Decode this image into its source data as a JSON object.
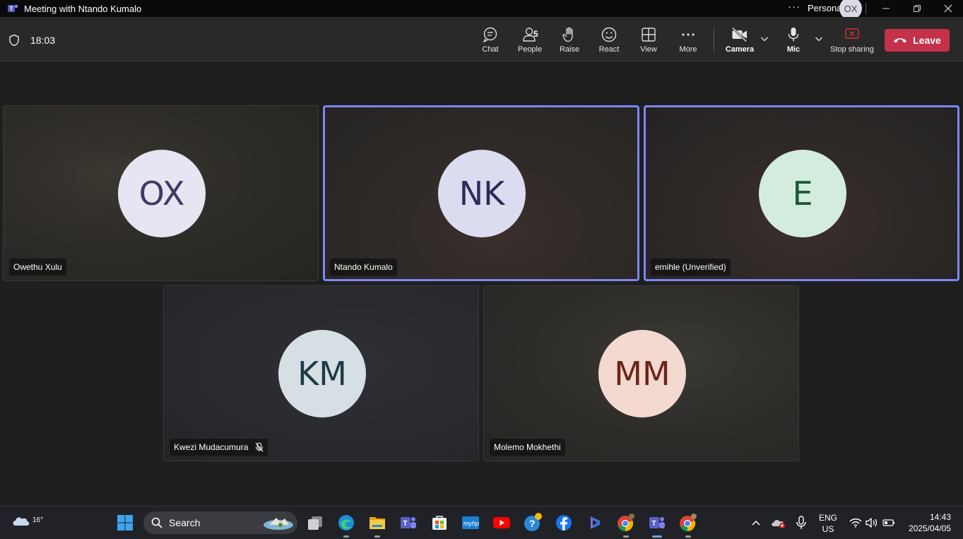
{
  "window": {
    "title": "Meeting with Ntando Kumalo",
    "profile_label": "Personal",
    "profile_initials": "OX",
    "more_dots": "···"
  },
  "toolbar": {
    "timer": "18:03",
    "chat": "Chat",
    "people": "People",
    "people_count": "5",
    "raise": "Raise",
    "react": "React",
    "view": "View",
    "more": "More",
    "camera": "Camera",
    "mic": "Mic",
    "stop_sharing": "Stop sharing",
    "leave": "Leave"
  },
  "participants": [
    {
      "initials": "OX",
      "name": "Owethu Xulu",
      "avatar_bg": "#e8e4f2",
      "avatar_fg": "#3e3a64",
      "speaking": false,
      "muted": false
    },
    {
      "initials": "NK",
      "name": "Ntando Kumalo",
      "avatar_bg": "#dcdcf0",
      "avatar_fg": "#2c2c5a",
      "speaking": true,
      "muted": false
    },
    {
      "initials": "E",
      "name": "emihle (Unverified)",
      "avatar_bg": "#d4ecde",
      "avatar_fg": "#1f5a36",
      "speaking": true,
      "muted": false
    },
    {
      "initials": "KM",
      "name": "Kwezi Mudacumura",
      "avatar_bg": "#d6e0e4",
      "avatar_fg": "#1d3b44",
      "speaking": false,
      "muted": true
    },
    {
      "initials": "MM",
      "name": "Molemo Mokhethi",
      "avatar_bg": "#f3d9d0",
      "avatar_fg": "#6b2418",
      "speaking": false,
      "muted": false
    }
  ],
  "taskbar": {
    "weather_temp": "16°",
    "search_label": "Search",
    "language": "ENG",
    "region": "US",
    "time": "14:43",
    "date": "2025/04/05"
  },
  "colors": {
    "accent": "#7f85f5",
    "leave": "#c4314b"
  }
}
